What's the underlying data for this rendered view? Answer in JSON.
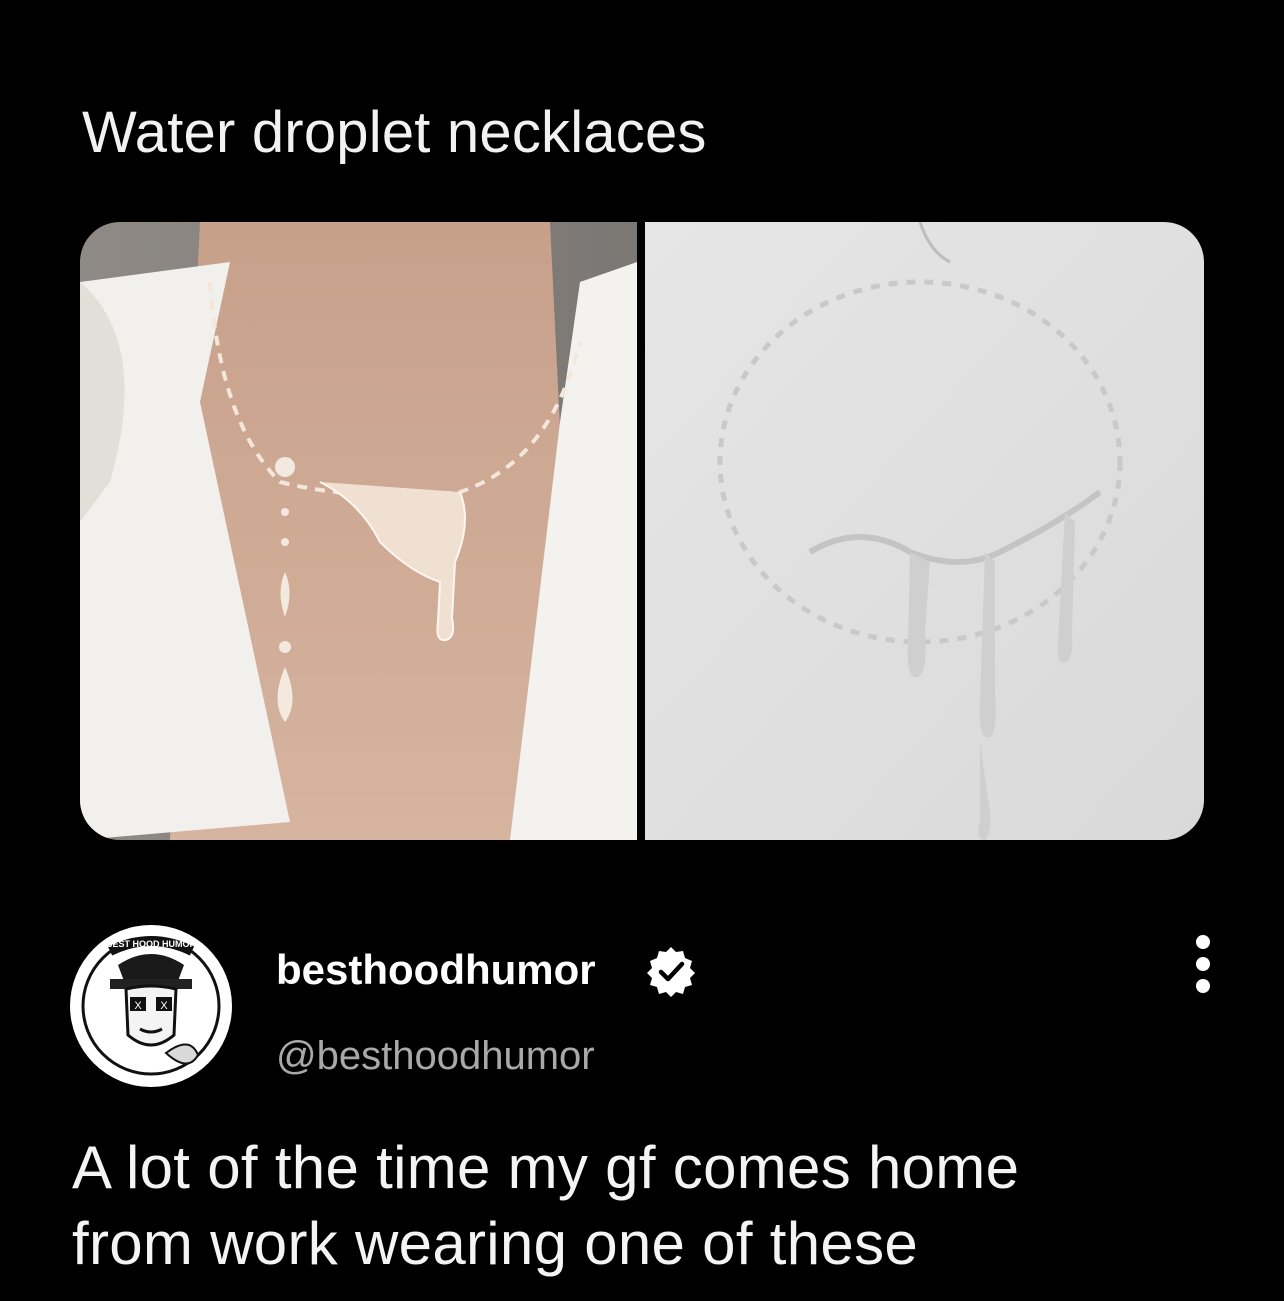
{
  "post": {
    "title": "Water droplet necklaces",
    "body_lines": [
      "A lot of the time my gf comes home",
      "from work wearing one of these"
    ]
  },
  "author": {
    "display_name": "besthoodhumor",
    "handle": "@besthoodhumor",
    "verified": true,
    "avatar_logo_text": "BEST HOOD HUMOR"
  },
  "icons": {
    "verified": "verified-badge-icon",
    "more": "more-options-icon"
  },
  "colors": {
    "background": "#000000",
    "text": "#ffffff",
    "handle": "#a9a9a9"
  }
}
